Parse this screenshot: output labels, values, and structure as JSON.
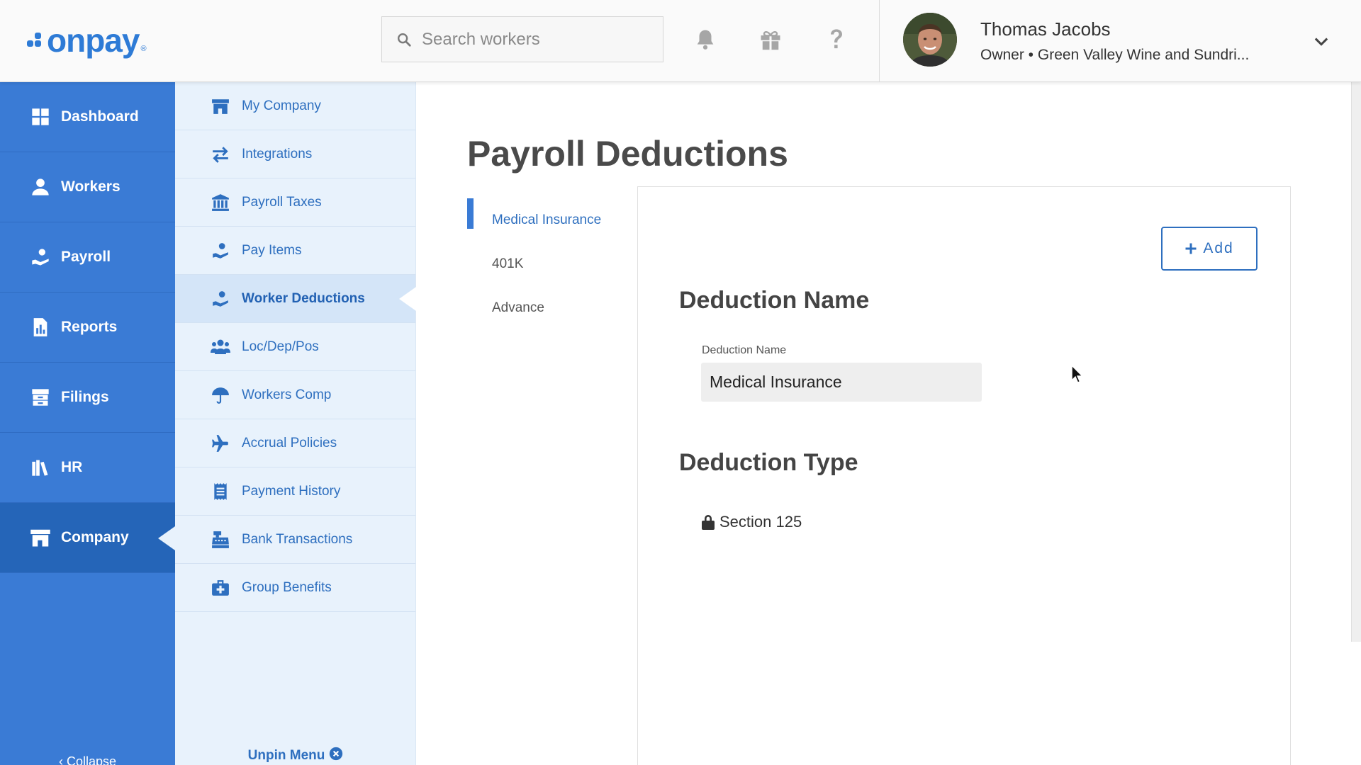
{
  "app": {
    "logo_text": "onpay",
    "logo_reg": "®",
    "brand_color": "#3a7bd5"
  },
  "header": {
    "search_placeholder": "Search workers",
    "icons": [
      "bell-icon",
      "gift-icon",
      "help-icon"
    ],
    "user": {
      "name": "Thomas Jacobs",
      "role": "Owner • Green Valley Wine and Sundri..."
    }
  },
  "primary_nav": {
    "items": [
      {
        "label": "Dashboard",
        "icon": "dashboard-icon"
      },
      {
        "label": "Workers",
        "icon": "workers-icon"
      },
      {
        "label": "Payroll",
        "icon": "payroll-icon"
      },
      {
        "label": "Reports",
        "icon": "reports-icon"
      },
      {
        "label": "Filings",
        "icon": "filings-icon"
      },
      {
        "label": "HR",
        "icon": "hr-icon"
      },
      {
        "label": "Company",
        "icon": "company-icon",
        "active": true
      }
    ],
    "collapse_label": "Collapse"
  },
  "secondary_nav": {
    "items": [
      {
        "label": "My Company",
        "icon": "store-icon"
      },
      {
        "label": "Integrations",
        "icon": "swap-arrows-icon"
      },
      {
        "label": "Payroll Taxes",
        "icon": "bank-icon"
      },
      {
        "label": "Pay Items",
        "icon": "hand-coin-icon"
      },
      {
        "label": "Worker Deductions",
        "icon": "hand-coin-icon",
        "active": true
      },
      {
        "label": "Loc/Dep/Pos",
        "icon": "people-group-icon"
      },
      {
        "label": "Workers Comp",
        "icon": "umbrella-icon"
      },
      {
        "label": "Accrual Policies",
        "icon": "airplane-icon"
      },
      {
        "label": "Payment History",
        "icon": "receipt-icon"
      },
      {
        "label": "Bank Transactions",
        "icon": "cash-register-icon"
      },
      {
        "label": "Group Benefits",
        "icon": "medical-kit-icon"
      }
    ],
    "unpin_label": "Unpin Menu"
  },
  "main": {
    "title": "Payroll Deductions",
    "deduction_tabs": [
      {
        "label": "Medical Insurance",
        "active": true
      },
      {
        "label": "401K"
      },
      {
        "label": "Advance"
      }
    ],
    "add_button_label": "Add",
    "deduction_name_heading": "Deduction Name",
    "deduction_name_field_label": "Deduction Name",
    "deduction_name_value": "Medical Insurance",
    "deduction_type_heading": "Deduction Type",
    "deduction_type_value": "Section 125"
  }
}
